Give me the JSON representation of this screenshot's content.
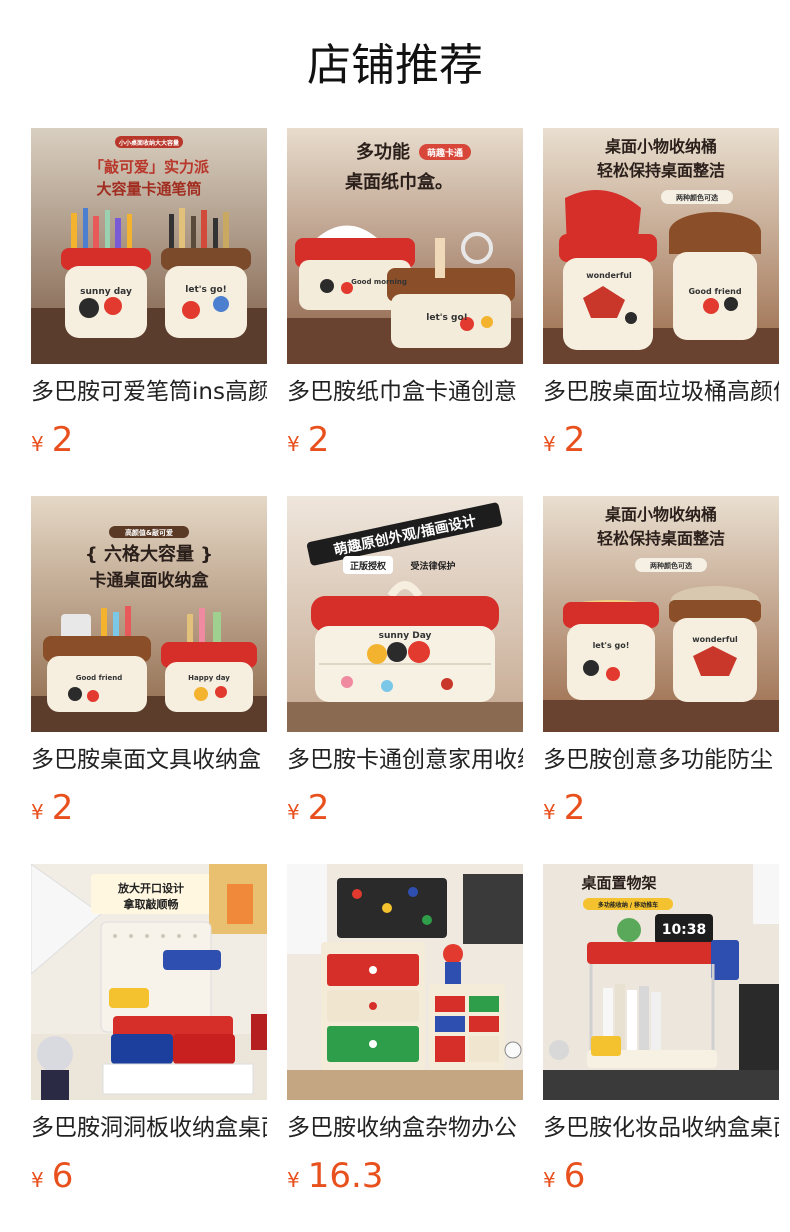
{
  "page": {
    "title": "店铺推荐"
  },
  "currency_symbol": "¥",
  "colors": {
    "price": "#e8501d",
    "title": "#111111",
    "name": "#222222"
  },
  "products": [
    {
      "name": "多巴胺可爱笔筒ins高颜值",
      "price": "2",
      "image": {
        "icon": "pen-holder-product-photo",
        "lines": [
          "小小桌面收纳大大容量",
          "「敲可爱」实力派",
          "大容量卡通笔筒"
        ],
        "stickers": [
          "sunny day",
          "let's go!"
        ]
      }
    },
    {
      "name": "多巴胺纸巾盒卡通创意",
      "price": "2",
      "image": {
        "icon": "tissue-box-product-photo",
        "lines": [
          "多功能",
          "萌趣卡通",
          "桌面纸巾盒。"
        ],
        "stickers": [
          "Good morning",
          "let's go!"
        ]
      }
    },
    {
      "name": "多巴胺桌面垃圾桶高颜值",
      "price": "2",
      "image": {
        "icon": "trash-bin-product-photo",
        "lines": [
          "桌面小物收纳桶",
          "轻松保持桌面整洁",
          "两种颜色可选"
        ],
        "stickers": [
          "wonderful",
          "Good friend"
        ]
      }
    },
    {
      "name": "多巴胺桌面文具收纳盒",
      "price": "2",
      "image": {
        "icon": "stationery-organizer-product-photo",
        "lines": [
          "高颜值&敲可爱",
          "{ 六格大容量 }",
          "卡通桌面收纳盒"
        ],
        "stickers": [
          "Good friend",
          "Happy day"
        ]
      }
    },
    {
      "name": "多巴胺卡通创意家用收纳",
      "price": "2",
      "image": {
        "icon": "storage-box-product-photo",
        "lines": [
          "萌趣原创外观/插画设计",
          "正版授权",
          "受法律保护"
        ],
        "stickers": [
          "sunny Day"
        ]
      }
    },
    {
      "name": "多巴胺创意多功能防尘",
      "price": "2",
      "image": {
        "icon": "storage-bucket-product-photo",
        "lines": [
          "桌面小物收纳桶",
          "轻松保持桌面整洁",
          "两种颜色可选"
        ],
        "stickers": [
          "wonderful",
          "let's go!"
        ]
      }
    },
    {
      "name": "多巴胺洞洞板收纳盒桌面",
      "price": "6",
      "image": {
        "icon": "pegboard-organizer-product-photo",
        "lines": [
          "放大开口设计",
          "拿取敲顺畅"
        ],
        "stickers": []
      }
    },
    {
      "name": "多巴胺收纳盒杂物办公",
      "price": "16.3",
      "image": {
        "icon": "drawer-cabinet-product-photo",
        "lines": [],
        "stickers": []
      }
    },
    {
      "name": "多巴胺化妆品收纳盒桌面",
      "price": "6",
      "image": {
        "icon": "desk-shelf-product-photo",
        "lines": [
          "桌面置物架",
          "多功能收纳 / 移动推车"
        ],
        "stickers": [
          "10:38"
        ]
      }
    }
  ]
}
